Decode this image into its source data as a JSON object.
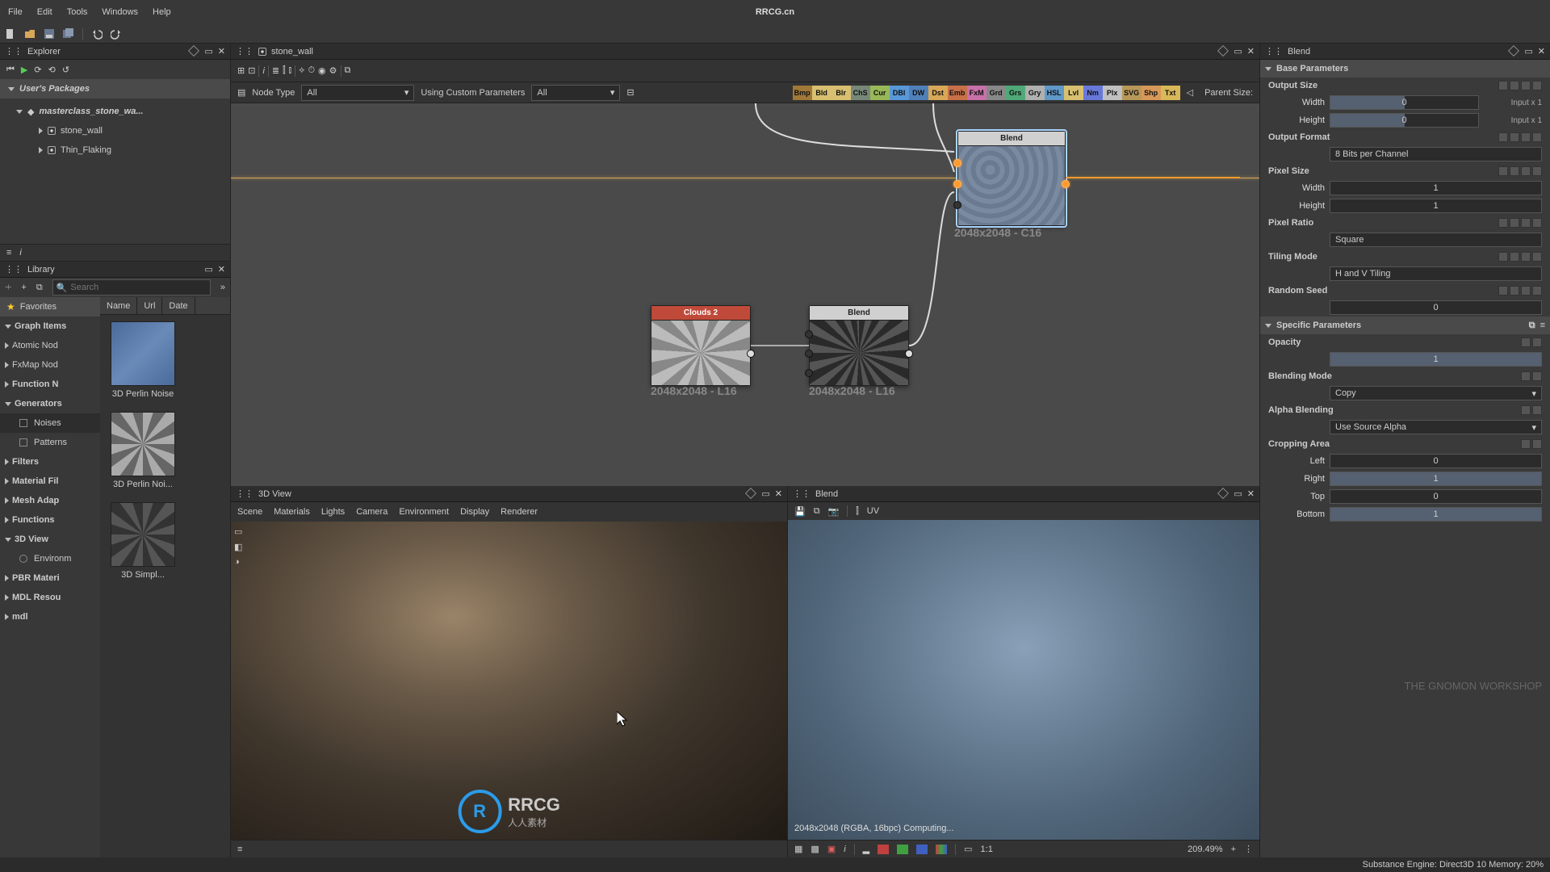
{
  "app": {
    "title": "RRCG.cn"
  },
  "menus": {
    "file": "File",
    "edit": "Edit",
    "tools": "Tools",
    "windows": "Windows",
    "help": "Help"
  },
  "explorer": {
    "title": "Explorer",
    "packages_header": "User's Packages",
    "pkg": "masterclass_stone_wa...",
    "children": [
      "stone_wall",
      "Thin_Flaking"
    ]
  },
  "library": {
    "title": "Library",
    "search_placeholder": "Search",
    "cols": {
      "name": "Name",
      "url": "Url",
      "date": "Date"
    },
    "tree": {
      "favorites": "Favorites",
      "graph_items": "Graph Items",
      "atomic_nodes": "Atomic Nod",
      "fxmap_nodes": "FxMap Nod",
      "function_nodes": "Function N",
      "generators": "Generators",
      "noises": "Noises",
      "patterns": "Patterns",
      "filters": "Filters",
      "material_filters": "Material Fil",
      "mesh_adaptive": "Mesh Adap",
      "functions": "Functions",
      "three_d_view": "3D View",
      "environment": "Environm",
      "pbr_materials": "PBR Materi",
      "mdl_resources": "MDL Resou",
      "mdl": "mdl"
    },
    "thumbs": [
      "3D Perlin Noise",
      "3D Perlin Noi...",
      "3D Simpl..."
    ]
  },
  "graph": {
    "tab": "stone_wall",
    "node_type_label": "Node Type",
    "node_type_value": "All",
    "custom_label": "Using Custom Parameters",
    "custom_value": "All",
    "pills": [
      "Bmp",
      "Bld",
      "Blr",
      "ChS",
      "Cur",
      "DBl",
      "DW",
      "Dst",
      "Emb",
      "FxM",
      "Grd",
      "Grs",
      "Gry",
      "HSL",
      "Lvl",
      "Nm",
      "Plx",
      "SVG",
      "Shp",
      "Txt"
    ],
    "pill_colors": [
      "#a07838",
      "#d8c070",
      "#d8c070",
      "#788878",
      "#98b858",
      "#5898d8",
      "#5080b8",
      "#d8a858",
      "#c87048",
      "#c870a8",
      "#888888",
      "#50a878",
      "#b0b0b0",
      "#6098c8",
      "#d8c070",
      "#6878d8",
      "#c0c0c0",
      "#b89858",
      "#d89858",
      "#d8b858"
    ],
    "parent_size": "Parent Size:",
    "nodes": {
      "blend1": "Blend",
      "clouds": "Clouds 2",
      "blend2": "Blend"
    },
    "dims1": "2048x2048 - C16",
    "dims2": "2048x2048 - L16",
    "dims3": "2048x2048 - L16"
  },
  "view3d": {
    "title": "3D View",
    "menu": [
      "Scene",
      "Materials",
      "Lights",
      "Camera",
      "Environment",
      "Display",
      "Renderer"
    ]
  },
  "view2d": {
    "title": "Blend",
    "uv": "UV",
    "status": "2048x2048 (RGBA, 16bpc)  Computing...",
    "ratio": "1:1",
    "zoom": "209.49%"
  },
  "props": {
    "title": "Blend",
    "base": "Base Parameters",
    "output_size": "Output Size",
    "width": "Width",
    "height": "Height",
    "width_val": "0",
    "height_val": "0",
    "inputx": "Input x 1",
    "output_format": "Output Format",
    "format_val": "8 Bits per Channel",
    "pixel_size": "Pixel Size",
    "psize_w": "1",
    "psize_h": "1",
    "pixel_ratio": "Pixel Ratio",
    "ratio_val": "Square",
    "tiling_mode": "Tiling Mode",
    "tiling_val": "H and V Tiling",
    "random_seed": "Random Seed",
    "seed_val": "0",
    "specific": "Specific Parameters",
    "opacity": "Opacity",
    "opacity_val": "1",
    "blending_mode": "Blending Mode",
    "blend_val": "Copy",
    "alpha_blending": "Alpha Blending",
    "alpha_val": "Use Source Alpha",
    "cropping": "Cropping Area",
    "left": "Left",
    "right": "Right",
    "top": "Top",
    "bottom": "Bottom",
    "left_v": "0",
    "right_v": "1",
    "top_v": "0",
    "bottom_v": "1"
  },
  "footer": {
    "engine": "Substance Engine: Direct3D 10  Memory: 20%"
  },
  "watermark": {
    "text": "RRCG",
    "sub": "人人素材"
  },
  "gnomon": "THE GNOMON WORKSHOP"
}
